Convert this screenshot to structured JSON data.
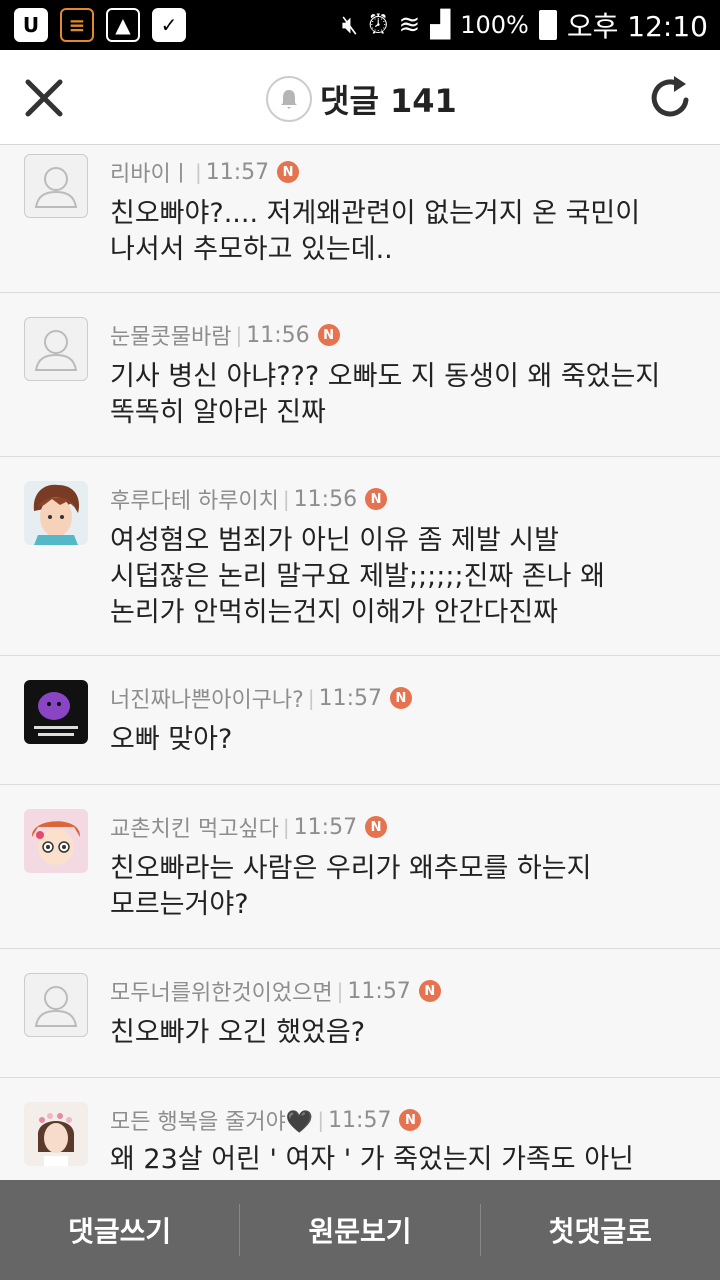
{
  "status_bar": {
    "battery": "100%",
    "time": "오후 12:10",
    "left_icons": [
      "u-plus-icon",
      "memo-icon",
      "gallery-icon",
      "briefcase-icon"
    ],
    "right_icons": [
      "mute-icon",
      "alarm-icon",
      "wifi-icon",
      "signal-icon",
      "battery-icon"
    ]
  },
  "header": {
    "title": "댓글 141",
    "close_icon": "close-icon",
    "bell_icon": "bell-icon",
    "refresh_icon": "refresh-icon"
  },
  "comments": [
    {
      "author": "리바이ㅣ",
      "time": "11:57",
      "badge": "N",
      "avatar": "default-avatar",
      "text": "친오빠야?.... 저게왜관련이 없는거지 온 국민이\n나서서 추모하고 있는데.."
    },
    {
      "author": "눈물콧물바람",
      "time": "11:56",
      "badge": "N",
      "avatar": "default-avatar",
      "text": "기사 병신 아냐??? 오빠도 지 동생이 왜 죽었는지\n똑똑히 알아라 진짜"
    },
    {
      "author": "후루다테 하루이치",
      "time": "11:56",
      "badge": "N",
      "avatar": "anime-boy-avatar",
      "text": "여성혐오 범죄가 아닌 이유 좀 제발 시발\n시덥잖은 논리 말구요 제발;;;;;;진짜 존나 왜\n논리가 안먹히는건지 이해가 안간다진짜"
    },
    {
      "author": "너진짜나쁜아이구나?",
      "time": "11:57",
      "badge": "N",
      "avatar": "purple-character-avatar",
      "text": "오빠 맞아?"
    },
    {
      "author": "교촌치킨 먹고싶다",
      "time": "11:57",
      "badge": "N",
      "avatar": "cartoon-girl-avatar",
      "text": "친오빠라는 사람은 우리가 왜추모를 하는지\n모르는거야?"
    },
    {
      "author": "모두너를위한것이었으면",
      "time": "11:57",
      "badge": "N",
      "avatar": "default-avatar",
      "text": "친오빠가 오긴 했었음?"
    },
    {
      "author": "모든 행복을 줄거야🖤",
      "time": "11:57",
      "badge": "N",
      "avatar": "photo-girl-avatar",
      "text": "왜 23살 어린 ' 여자 ' 가 죽었는지 가족도 아닌"
    }
  ],
  "bottom_bar": {
    "write": "댓글쓰기",
    "original": "원문보기",
    "first": "첫댓글로"
  }
}
